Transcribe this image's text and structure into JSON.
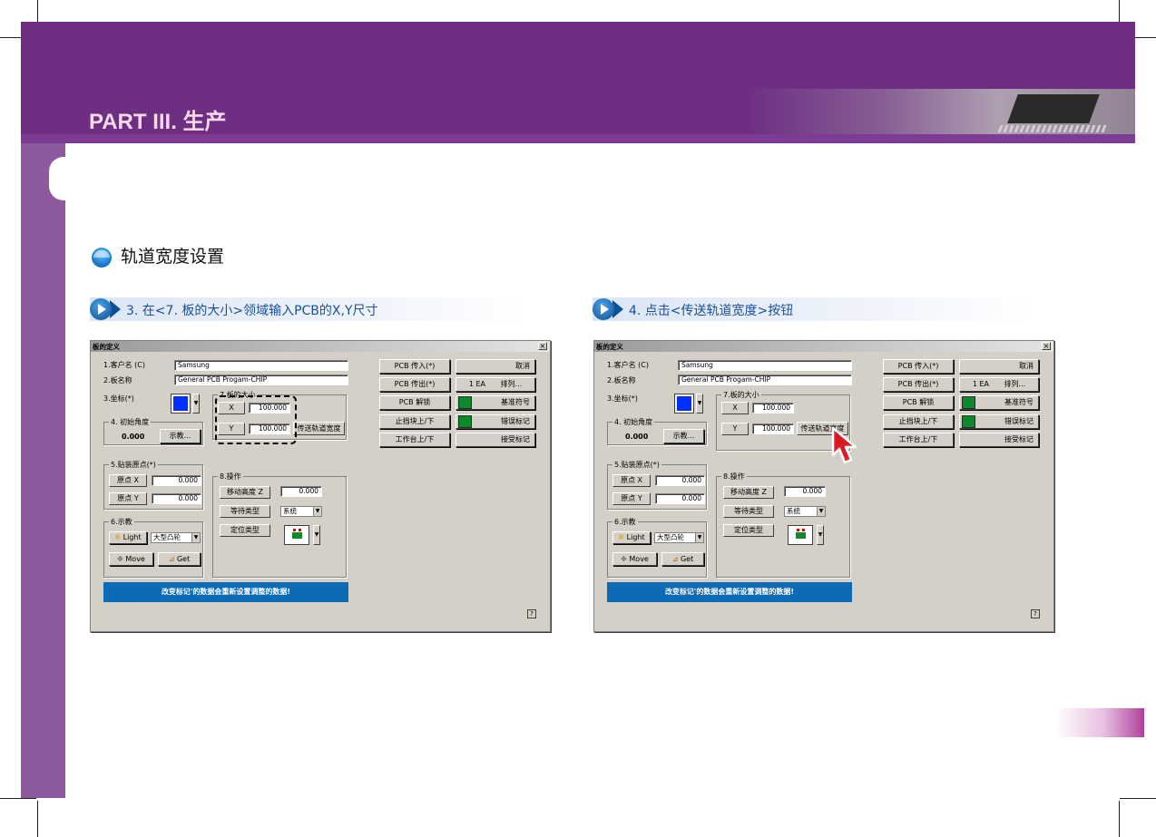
{
  "header": {
    "part_title": "PART III. 生产"
  },
  "section": {
    "title": "轨道宽度设置"
  },
  "steps": [
    {
      "label": "3. 在<7. 板的大小>领域输入PCB的X,Y尺寸"
    },
    {
      "label": "4. 点击<传送轨道宽度>按钮"
    }
  ],
  "dialog": {
    "title": "板的定义",
    "close": "×",
    "labels": {
      "customer": "1.客户名 (C)",
      "board_name": "2.板名称",
      "coord": "3.坐标(*)",
      "init_angle": "4. 初始角度",
      "board_size": "7.板的大小",
      "fiducial": "5.贴装原点(*)",
      "operation": "8.操作",
      "teach": "6.示教"
    },
    "values": {
      "customer": "Samsung",
      "board_name": "General PCB Progam-CHIP",
      "init_angle": "0.000",
      "size_x": "100.000",
      "size_y": "100.000",
      "origin_x": "0.000",
      "origin_y": "0.000",
      "move_height_z": "0.000",
      "wait_type": "系统",
      "teach_light_type": "大型凸轮"
    },
    "buttons": {
      "teach_angle": "示教...",
      "x": "X",
      "y": "Y",
      "conveyor_width": "传送轨道宽度",
      "origin_x": "原点 X",
      "origin_y": "原点 Y",
      "move_height_z": "移动高度 Z",
      "wait_type": "等待类型",
      "locate_type": "定位类型",
      "light": "Light",
      "move": "Move",
      "get": "Get",
      "pcb_in": "PCB 传入(*)",
      "pcb_out": "PCB 传出(*)",
      "pcb_unlock": "PCB 解锁",
      "stopper": "止挡块上/下",
      "table": "工作台上/下",
      "cancel": "取消",
      "array_count": "1 EA",
      "array": "排列...",
      "fiducial": "基准符号",
      "bad_mark": "错误标记",
      "accept_mark": "接受标记",
      "help": "?"
    },
    "status": "改变标记'的数据会重新设置调整的数据!"
  },
  "colors": {
    "header_purple": "#6e2f83",
    "side_purple": "#8e5a9e",
    "title_pink": "#f7d9ea",
    "step_blue": "#1a4f9b",
    "status_blue": "#0d6ab5",
    "fiducial_green": "#0a8a2a",
    "cursor_red": "#e8202a"
  }
}
